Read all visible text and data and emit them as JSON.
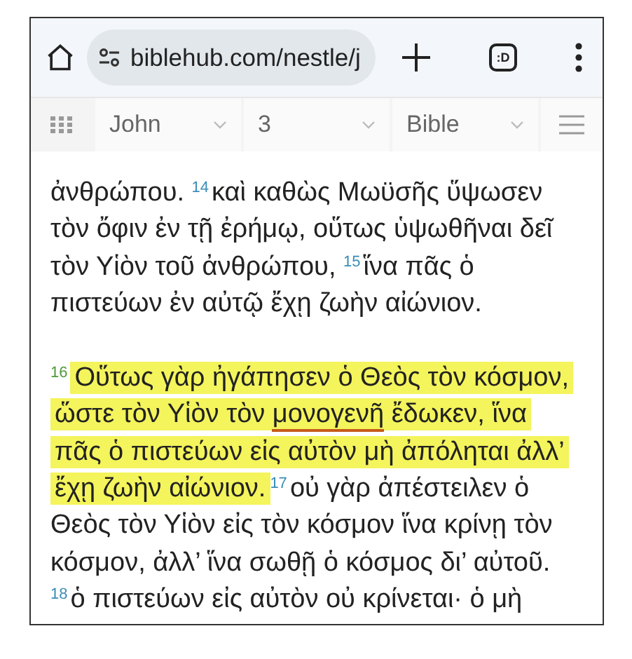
{
  "browser": {
    "url": "biblehub.com/nestle/j",
    "tab_badge": ":D"
  },
  "nav": {
    "selects": [
      {
        "label": "John"
      },
      {
        "label": "3"
      },
      {
        "label": "Bible"
      }
    ]
  },
  "paragraphs": [
    {
      "verses": [
        {
          "highlighted": false,
          "parts": [
            {
              "kind": "text",
              "text": "ἀνθρώπου. "
            }
          ]
        },
        {
          "number": "14",
          "highlighted": false,
          "parts": [
            {
              "kind": "text",
              "text": "καὶ καθὼς Μωϋσῆς ὕψωσεν"
            },
            {
              "kind": "break"
            },
            {
              "kind": "text",
              "text": "τὸν ὄφιν ἐν τῇ ἐρήμῳ, οὕτως ὑψωθῆναι δεῖ"
            },
            {
              "kind": "break"
            },
            {
              "kind": "text",
              "text": "τὸν Υἱὸν τοῦ ἀνθρώπου, "
            }
          ]
        },
        {
          "number": "15",
          "highlighted": false,
          "parts": [
            {
              "kind": "text",
              "text": "ἵνα πᾶς ὁ"
            },
            {
              "kind": "break"
            },
            {
              "kind": "text",
              "text": "πιστεύων ἐν αὐτῷ ἔχῃ ζωὴν αἰώνιον."
            }
          ]
        }
      ]
    },
    {
      "verses": [
        {
          "number": "16",
          "highlighted": true,
          "parts": [
            {
              "kind": "text",
              "text": "Οὕτως γὰρ ἠγάπησεν ὁ Θεὸς τὸν κόσμον,"
            },
            {
              "kind": "break"
            },
            {
              "kind": "text",
              "text": "ὥστε τὸν Υἱὸν τὸν "
            },
            {
              "kind": "underlined",
              "text": "μονογενῆ"
            },
            {
              "kind": "text",
              "text": " ἔδωκεν, ἵνα"
            },
            {
              "kind": "break"
            },
            {
              "kind": "text",
              "text": "πᾶς ὁ πιστεύων εἰς αὐτὸν μὴ ἀπόληται ἀλλ’"
            },
            {
              "kind": "break"
            },
            {
              "kind": "text",
              "text": "ἔχῃ ζωὴν αἰώνιον."
            }
          ]
        },
        {
          "number": "17",
          "highlighted": false,
          "parts": [
            {
              "kind": "text",
              "text": "οὐ γὰρ ἀπέστειλεν ὁ"
            },
            {
              "kind": "break"
            },
            {
              "kind": "text",
              "text": "Θεὸς τὸν Υἱὸν εἰς τὸν κόσμον ἵνα κρίνῃ τὸν"
            },
            {
              "kind": "break"
            },
            {
              "kind": "text",
              "text": "κόσμον, ἀλλ’ ἵνα σωθῇ ὁ κόσμος δι’ αὐτοῦ."
            },
            {
              "kind": "break"
            }
          ]
        },
        {
          "number": "18",
          "highlighted": false,
          "parts": [
            {
              "kind": "text",
              "text": "ὁ πιστεύων εἰς αὐτὸν οὐ κρίνεται· ὁ μὴ"
            }
          ]
        }
      ]
    }
  ]
}
